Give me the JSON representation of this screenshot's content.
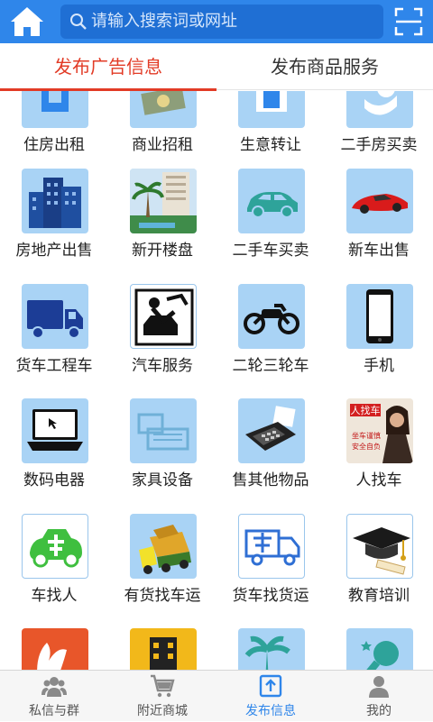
{
  "header": {
    "search_placeholder": "请输入搜索词或网址",
    "accent": "#2f86ea"
  },
  "tabs": [
    {
      "label": "发布广告信息",
      "active": true
    },
    {
      "label": "发布商品服务",
      "active": false
    }
  ],
  "categories": [
    {
      "label": "住房出租",
      "icon": "house-rent-icon"
    },
    {
      "label": "商业招租",
      "icon": "money-icon"
    },
    {
      "label": "生意转让",
      "icon": "shop-transfer-icon"
    },
    {
      "label": "二手房买卖",
      "icon": "hand-house-icon"
    },
    {
      "label": "房地产出售",
      "icon": "buildings-icon"
    },
    {
      "label": "新开楼盘",
      "icon": "new-estate-photo-icon"
    },
    {
      "label": "二手车买卖",
      "icon": "car-icon"
    },
    {
      "label": "新车出售",
      "icon": "red-sports-car-icon"
    },
    {
      "label": "货车工程车",
      "icon": "truck-icon"
    },
    {
      "label": "汽车服务",
      "icon": "car-repair-icon"
    },
    {
      "label": "二轮三轮车",
      "icon": "motorcycle-icon"
    },
    {
      "label": "手机",
      "icon": "mobile-phone-icon"
    },
    {
      "label": "数码电器",
      "icon": "laptop-icon"
    },
    {
      "label": "家具设备",
      "icon": "furniture-icon"
    },
    {
      "label": "售其他物品",
      "icon": "pos-terminal-icon"
    },
    {
      "label": "人找车",
      "icon": "person-seeks-car-icon"
    },
    {
      "label": "车找人",
      "icon": "carpool-car-icon"
    },
    {
      "label": "有货找车运",
      "icon": "loaded-truck-icon"
    },
    {
      "label": "货车找货运",
      "icon": "carpool-truck-icon"
    },
    {
      "label": "教育培训",
      "icon": "graduation-cap-icon"
    },
    {
      "label": "",
      "icon": "hands-icon"
    },
    {
      "label": "",
      "icon": "hotel-icon"
    },
    {
      "label": "",
      "icon": "palm-tree-icon"
    },
    {
      "label": "",
      "icon": "microphone-icon"
    }
  ],
  "person_seeks_car_image_text": [
    "人找车",
    "坐车谨慎",
    "安全自负"
  ],
  "bottom_nav": [
    {
      "label": "私信与群",
      "icon": "group-chat-icon",
      "active": false
    },
    {
      "label": "附近商城",
      "icon": "shopping-cart-icon",
      "active": false
    },
    {
      "label": "发布信息",
      "icon": "publish-upload-icon",
      "active": true
    },
    {
      "label": "我的",
      "icon": "user-profile-icon",
      "active": false
    }
  ]
}
